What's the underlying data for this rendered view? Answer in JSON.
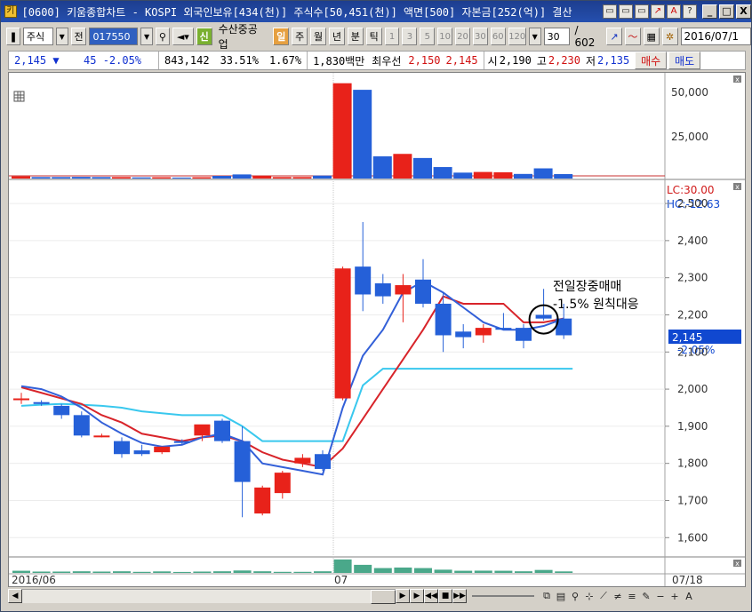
{
  "window": {
    "title": "[0600] 키움종합차트 - KOSPI 외국인보유[434(천)] 주식수[50,451(천)] 액면[500] 자본금[252(억)] 결산",
    "icon_glyph": "키",
    "minimize": "_",
    "maximize": "□",
    "close": "X",
    "tools": [
      "▭",
      "▭",
      "▭",
      "↗",
      "A",
      "?"
    ]
  },
  "toolbar": {
    "market": "주식",
    "prev_label": "전",
    "code": "017550",
    "credit_badge": "신",
    "stock_name": "수산중공업",
    "period_active": "일",
    "periods": [
      "주",
      "월",
      "년",
      "분",
      "틱"
    ],
    "minute_options": [
      "1",
      "3",
      "5",
      "10",
      "20",
      "30",
      "60",
      "120"
    ],
    "count_value": "30",
    "count_total": "/ 602",
    "date": "2016/07/1"
  },
  "quote": {
    "price": "2,145",
    "change_arrow": "▼",
    "change": "45",
    "change_pct": "-2.05%",
    "volume": "843,142",
    "turnover_pct": "33.51%",
    "ratio_pct": "1.67%",
    "amount": "1,830백만",
    "best_label": "최우선",
    "best_ask": "2,150",
    "best_bid": "2,145",
    "open_label": "시",
    "open": "2,190",
    "high_label": "고",
    "high": "2,230",
    "low_label": "저",
    "low": "2,135",
    "buy_button": "매수",
    "sell_button": "매도"
  },
  "colors": {
    "up": "#e8221a",
    "down": "#2560d8",
    "ma5": "#3360d8",
    "ma10": "#d8242a",
    "ma20": "#39c8ee",
    "volume_bar": "#4aa88a",
    "lc_color": "#d01818",
    "hc_color": "#1048d0"
  },
  "chart_data": {
    "type": "candlestick",
    "top_panel_ticks": [
      "50,000",
      "25,000"
    ],
    "price_ticks": [
      "2,500",
      "2,400",
      "2,300",
      "2,200",
      "2,100",
      "2,000",
      "1,900",
      "1,800",
      "1,700",
      "1,600"
    ],
    "lc_label": "LC:30.00",
    "hc_label": "HC:-12.63",
    "current_price_label": "2,145",
    "current_change_label": "-2.05%",
    "x_labels": [
      "2016/06",
      "07"
    ],
    "end_label": "07/18",
    "annotation_line1": "전일장중매매",
    "annotation_line2": "-1.5% 원칙대응",
    "candles": [
      {
        "o": 1975,
        "h": 1990,
        "l": 1960,
        "c": 1975,
        "up": true
      },
      {
        "o": 1965,
        "h": 1970,
        "l": 1955,
        "c": 1960,
        "up": false
      },
      {
        "o": 1955,
        "h": 1960,
        "l": 1920,
        "c": 1930,
        "up": false
      },
      {
        "o": 1930,
        "h": 1940,
        "l": 1870,
        "c": 1875,
        "up": false
      },
      {
        "o": 1875,
        "h": 1880,
        "l": 1870,
        "c": 1875,
        "up": true
      },
      {
        "o": 1860,
        "h": 1870,
        "l": 1815,
        "c": 1825,
        "up": false
      },
      {
        "o": 1835,
        "h": 1850,
        "l": 1820,
        "c": 1825,
        "up": false
      },
      {
        "o": 1830,
        "h": 1845,
        "l": 1825,
        "c": 1845,
        "up": true
      },
      {
        "o": 1855,
        "h": 1865,
        "l": 1850,
        "c": 1860,
        "up": false
      },
      {
        "o": 1875,
        "h": 1900,
        "l": 1860,
        "c": 1905,
        "up": true
      },
      {
        "o": 1915,
        "h": 1920,
        "l": 1855,
        "c": 1860,
        "up": false
      },
      {
        "o": 1860,
        "h": 1900,
        "l": 1655,
        "c": 1750,
        "up": false
      },
      {
        "o": 1665,
        "h": 1740,
        "l": 1660,
        "c": 1735,
        "up": true
      },
      {
        "o": 1720,
        "h": 1780,
        "l": 1705,
        "c": 1775,
        "up": true
      },
      {
        "o": 1800,
        "h": 1825,
        "l": 1790,
        "c": 1815,
        "up": true
      },
      {
        "o": 1825,
        "h": 1835,
        "l": 1780,
        "c": 1785,
        "up": false
      },
      {
        "o": 1975,
        "h": 2330,
        "l": 1970,
        "c": 2325,
        "up": true
      },
      {
        "o": 2330,
        "h": 2450,
        "l": 2210,
        "c": 2255,
        "up": false
      },
      {
        "o": 2285,
        "h": 2310,
        "l": 2230,
        "c": 2250,
        "up": false
      },
      {
        "o": 2255,
        "h": 2310,
        "l": 2180,
        "c": 2280,
        "up": true
      },
      {
        "o": 2295,
        "h": 2350,
        "l": 2220,
        "c": 2230,
        "up": false
      },
      {
        "o": 2230,
        "h": 2260,
        "l": 2100,
        "c": 2145,
        "up": false
      },
      {
        "o": 2155,
        "h": 2175,
        "l": 2110,
        "c": 2140,
        "up": false
      },
      {
        "o": 2145,
        "h": 2175,
        "l": 2125,
        "c": 2165,
        "up": true
      },
      {
        "o": 2165,
        "h": 2205,
        "l": 2160,
        "c": 2160,
        "up": false
      },
      {
        "o": 2165,
        "h": 2175,
        "l": 2110,
        "c": 2130,
        "up": false
      },
      {
        "o": 2200,
        "h": 2270,
        "l": 2185,
        "c": 2190,
        "up": false
      },
      {
        "o": 2190,
        "h": 2230,
        "l": 2135,
        "c": 2145,
        "up": false
      }
    ],
    "ma5": [
      2008,
      2000,
      1980,
      1950,
      1910,
      1880,
      1855,
      1845,
      1850,
      1870,
      1880,
      1860,
      1800,
      1790,
      1780,
      1770,
      1950,
      2090,
      2160,
      2260,
      2290,
      2260,
      2220,
      2180,
      2160,
      2160,
      2170,
      2190
    ],
    "ma10": [
      2005,
      1990,
      1975,
      1960,
      1930,
      1910,
      1880,
      1870,
      1860,
      1870,
      1875,
      1860,
      1830,
      1810,
      1800,
      1790,
      1840,
      1920,
      2000,
      2080,
      2160,
      2250,
      2230,
      2230,
      2230,
      2180,
      2180,
      2190
    ],
    "ma20": [
      1955,
      1958,
      1960,
      1958,
      1955,
      1950,
      1940,
      1935,
      1930,
      1930,
      1930,
      1900,
      1860,
      1860,
      1860,
      1860,
      1860,
      2010,
      2055,
      2055,
      2055,
      2055,
      2055,
      2055,
      2055,
      2055,
      2055,
      2055
    ],
    "top_bars": [
      {
        "v": 1300,
        "up": true
      },
      {
        "v": 900,
        "up": false
      },
      {
        "v": 900,
        "up": false
      },
      {
        "v": 1000,
        "up": false
      },
      {
        "v": 900,
        "up": false
      },
      {
        "v": 900,
        "up": true
      },
      {
        "v": 700,
        "up": false
      },
      {
        "v": 800,
        "up": true
      },
      {
        "v": 600,
        "up": false
      },
      {
        "v": 800,
        "up": true
      },
      {
        "v": 1600,
        "up": false
      },
      {
        "v": 2500,
        "up": false
      },
      {
        "v": 1600,
        "up": true
      },
      {
        "v": 900,
        "up": true
      },
      {
        "v": 900,
        "up": true
      },
      {
        "v": 1800,
        "up": false
      },
      {
        "v": 58000,
        "up": true
      },
      {
        "v": 54000,
        "up": false
      },
      {
        "v": 13500,
        "up": false
      },
      {
        "v": 15000,
        "up": true
      },
      {
        "v": 12500,
        "up": false
      },
      {
        "v": 7000,
        "up": false
      },
      {
        "v": 3600,
        "up": false
      },
      {
        "v": 4000,
        "up": true
      },
      {
        "v": 3800,
        "up": true
      },
      {
        "v": 2800,
        "up": false
      },
      {
        "v": 6200,
        "up": false
      },
      {
        "v": 2700,
        "up": false
      }
    ],
    "volume": [
      40,
      25,
      25,
      30,
      25,
      30,
      20,
      28,
      18,
      25,
      30,
      45,
      30,
      20,
      20,
      30,
      250,
      150,
      90,
      100,
      90,
      60,
      40,
      42,
      40,
      30,
      55,
      28
    ],
    "top_ylim": [
      0,
      60000
    ],
    "price_ylim": [
      1560,
      2560
    ],
    "volume_ylim": [
      0,
      280
    ]
  },
  "scroll": {
    "left_arrow": "◀",
    "right_arrow": "▶",
    "play": "▶",
    "rewind": "◀◀",
    "stop": "■",
    "forward": "▶▶",
    "zoom_minus": "−",
    "zoom_plus": "+",
    "text_tool": "A"
  }
}
